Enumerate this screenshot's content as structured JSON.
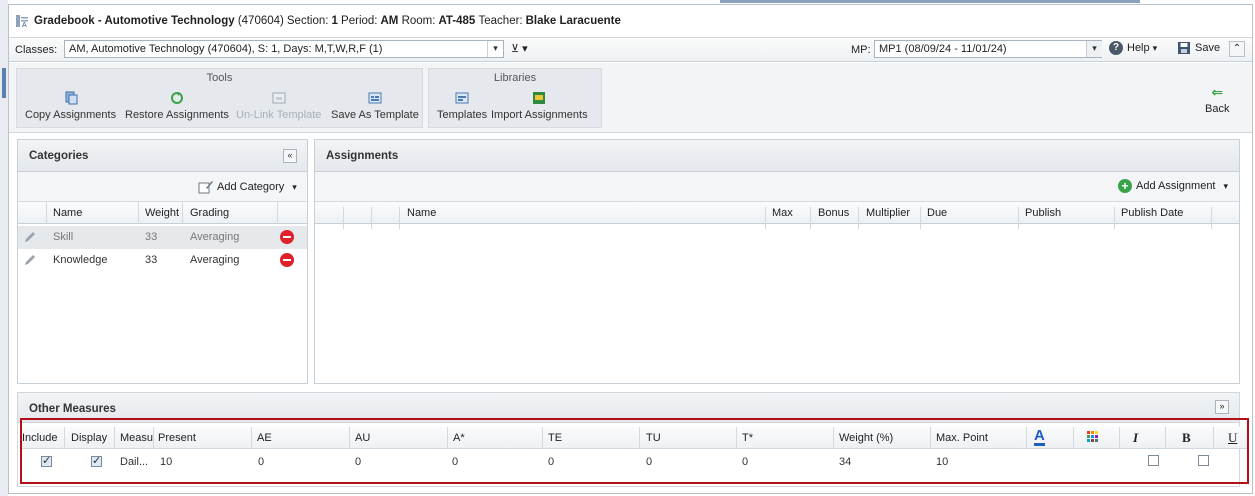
{
  "title": {
    "prefix": "Gradebook - Automotive Technology",
    "course_code": "(470604)",
    "section_label": "Section:",
    "section": "1",
    "period_label": "Period:",
    "period": "AM",
    "room_label": "Room:",
    "room": "AT-485",
    "teacher_label": "Teacher:",
    "teacher": "Blake Laracuente"
  },
  "classrow": {
    "classes_label": "Classes:",
    "classes_value": "AM, Automotive Technology (470604), S: 1, Days: M,T,W,R,F (1)",
    "filter_icon": "filter-icon",
    "mp_label": "MP:",
    "mp_value": "MP1 (08/09/24 - 11/01/24)",
    "help_label": "Help",
    "save_label": "Save"
  },
  "ribbon": {
    "tools_title": "Tools",
    "libraries_title": "Libraries",
    "copy": "Copy Assignments",
    "restore": "Restore Assignments",
    "unlink": "Un-Link Template",
    "saveas": "Save As Template",
    "templates": "Templates",
    "import": "Import Assignments",
    "back": "Back"
  },
  "categories": {
    "title": "Categories",
    "add_label": "Add Category",
    "headers": [
      "Name",
      "Weight",
      "Grading"
    ],
    "rows": [
      {
        "name": "Skill",
        "weight": "33",
        "grading": "Averaging"
      },
      {
        "name": "Knowledge",
        "weight": "33",
        "grading": "Averaging"
      }
    ]
  },
  "assignments": {
    "title": "Assignments",
    "add_label": "Add Assignment",
    "headers": [
      "Name",
      "Max",
      "Bonus",
      "Multiplier",
      "Due",
      "Publish",
      "Publish Date"
    ]
  },
  "other": {
    "title": "Other Measures",
    "headers": [
      "Include",
      "Display",
      "Measu",
      "Present",
      "AE",
      "AU",
      "A*",
      "TE",
      "TU",
      "T*",
      "Weight (%)",
      "Max. Point",
      "A",
      "I",
      "B",
      "U"
    ],
    "row": {
      "measure": "Dail...",
      "present": "10",
      "ae": "0",
      "au": "0",
      "astar": "0",
      "te": "0",
      "tu": "0",
      "tstar": "0",
      "weight": "34",
      "maxpoint": "10"
    }
  },
  "colors": {
    "accent_red": "#b20f18",
    "delete_red": "#e0202a",
    "font_color_icon": "#1f5fbf",
    "add_green": "#3aa34a"
  }
}
